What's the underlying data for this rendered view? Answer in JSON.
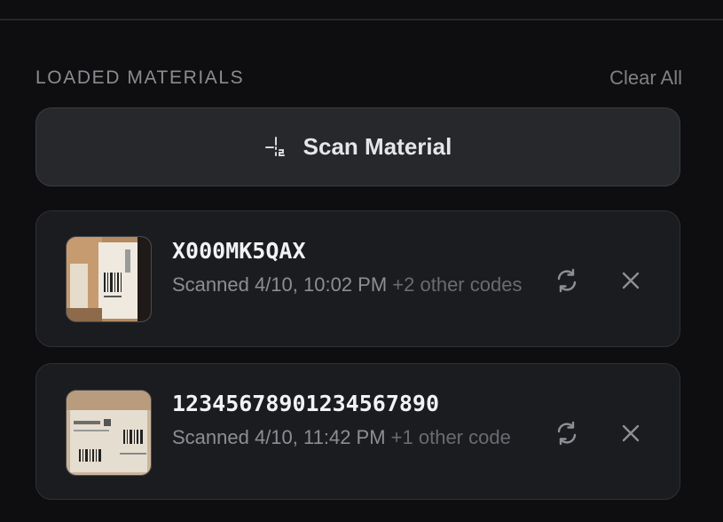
{
  "section": {
    "title": "LOADED MATERIALS",
    "clear_all_label": "Clear All"
  },
  "scan_button": {
    "label": "Scan Material",
    "icon": "scan-icon"
  },
  "materials": [
    {
      "code": "X000MK5QAX",
      "scanned": "Scanned 4/10, 10:02 PM",
      "extra": "+2 other codes",
      "thumbnail": "scanned-package-photo",
      "actions": [
        "rescan-icon",
        "close-icon"
      ]
    },
    {
      "code": "12345678901234567890",
      "scanned": "Scanned 4/10, 11:42 PM",
      "extra": "+1 other code",
      "thumbnail": "scanned-package-photo",
      "actions": [
        "rescan-icon",
        "close-icon"
      ]
    }
  ],
  "colors": {
    "background": "#0e0e10",
    "card": "#1b1c1f",
    "button": "#27282c",
    "muted_text": "#8d8e93"
  }
}
